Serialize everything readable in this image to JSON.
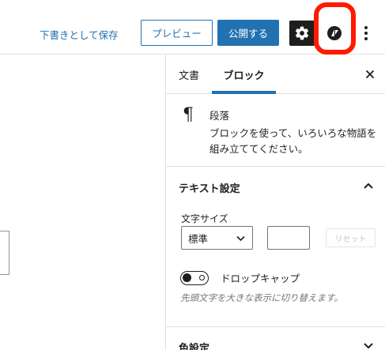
{
  "toolbar": {
    "save_draft_label": "下書きとして保存",
    "preview_label": "プレビュー",
    "publish_label": "公開する",
    "accent_color": "#2271b1",
    "highlight_color": "#ff1a00"
  },
  "sidebar": {
    "tabs": [
      {
        "label": "文書",
        "active": false
      },
      {
        "label": "ブロック",
        "active": true
      }
    ],
    "block": {
      "icon": "¶",
      "title": "段落",
      "description": "ブロックを使って、いろいろな物語を組み立ててください。"
    },
    "text_settings": {
      "title": "テキスト設定",
      "font_size_label": "文字サイズ",
      "font_size_value": "標準",
      "custom_size_value": "",
      "reset_label": "リセット",
      "drop_cap_label": "ドロップキャップ",
      "drop_cap_help": "先頭文字を大きな表示に切り替えます。",
      "drop_cap_enabled": false
    },
    "color_settings": {
      "title": "色設定"
    }
  }
}
